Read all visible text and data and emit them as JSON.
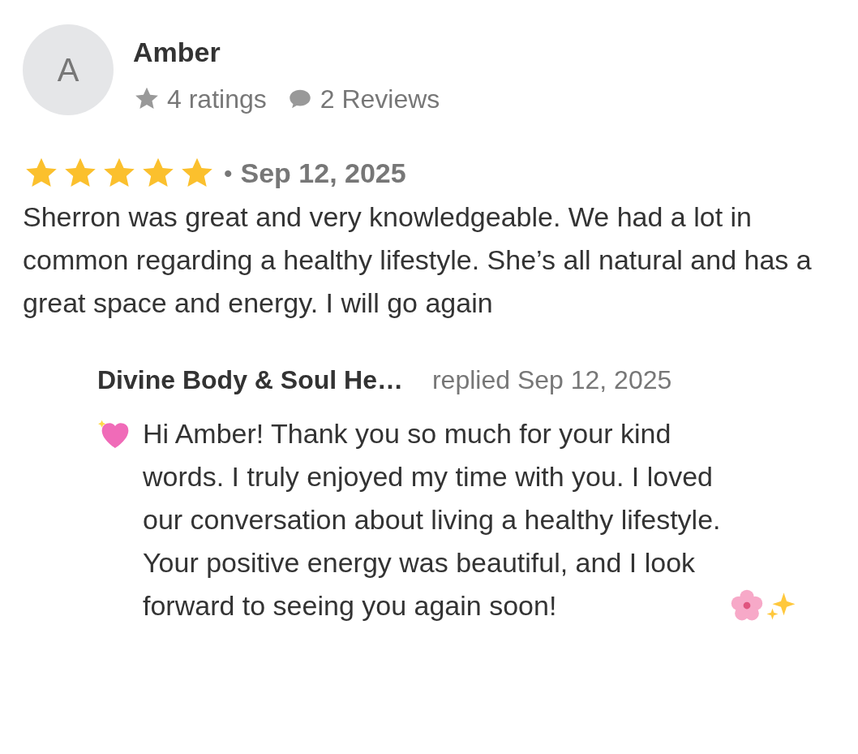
{
  "reviewer": {
    "avatar_letter": "A",
    "name": "Amber",
    "ratings": "4 ratings",
    "reviews": "2 Reviews"
  },
  "review": {
    "stars": 5,
    "separator": "•",
    "date": "Sep 12, 2025",
    "text": "Sherron was great and very knowledgeable. We had a lot in common regarding a healthy lifestyle. She’s all natural and has a great space and energy. I will go again"
  },
  "reply": {
    "author": "Divine Body & Soul He…",
    "replied": "replied Sep 12, 2025",
    "text": "Hi Amber! Thank you so much for your kind words. I truly enjoyed my time with you. I loved our conversation about living a healthy lifestyle. Your positive energy was beautiful, and I look forward to seeing you again soon!"
  }
}
